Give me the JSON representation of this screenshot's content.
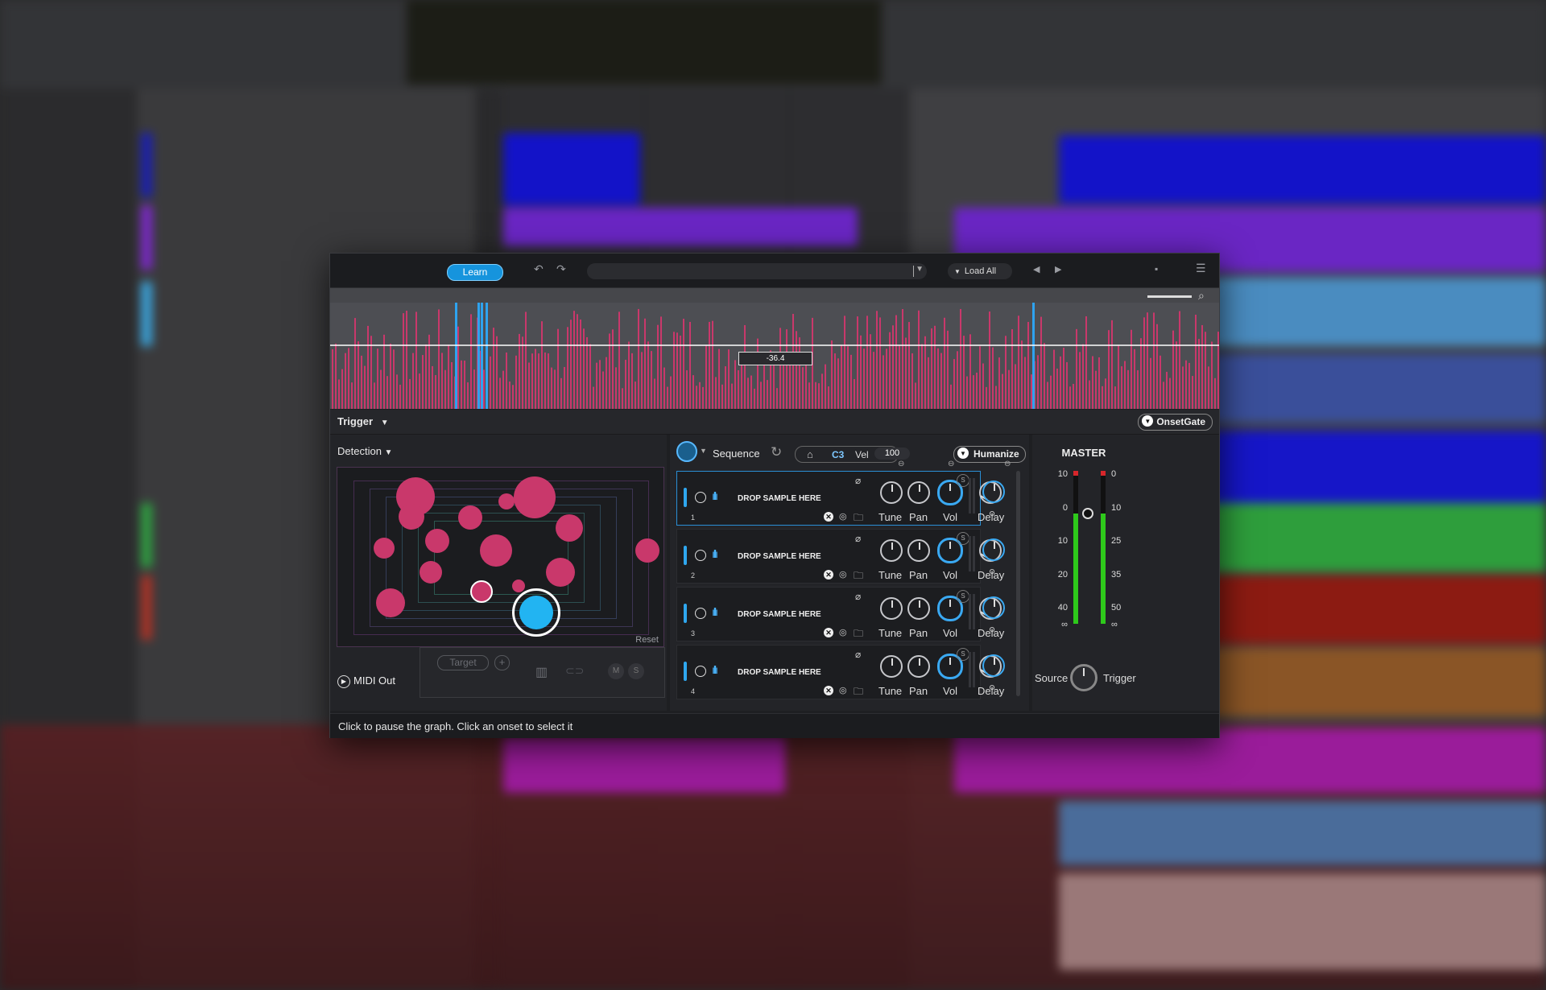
{
  "toolbar": {
    "learn_label": "Learn",
    "preset_name": "",
    "load_all_label": "Load All"
  },
  "waveform": {
    "threshold_value": "-36.4"
  },
  "trigger_bar": {
    "trigger_label": "Trigger",
    "mode_label": "OnsetGate"
  },
  "detection": {
    "label": "Detection",
    "reset_label": "Reset",
    "midi_out_label": "MIDI Out",
    "target_label": "Target",
    "m_label": "M",
    "s_label": "S"
  },
  "sequence": {
    "label": "Sequence",
    "note": "C3",
    "vel_label": "Vel",
    "vel_value": "100",
    "humanize_label": "Humanize",
    "slots": [
      {
        "number": "1",
        "drop_label": "DROP SAMPLE HERE",
        "tune": "Tune",
        "pan": "Pan",
        "vol": "Vol",
        "delay": "Delay",
        "s_badge": "S"
      },
      {
        "number": "2",
        "drop_label": "DROP SAMPLE HERE",
        "tune": "Tune",
        "pan": "Pan",
        "vol": "Vol",
        "delay": "Delay",
        "s_badge": "S"
      },
      {
        "number": "3",
        "drop_label": "DROP SAMPLE HERE",
        "tune": "Tune",
        "pan": "Pan",
        "vol": "Vol",
        "delay": "Delay",
        "s_badge": "S"
      },
      {
        "number": "4",
        "drop_label": "DROP SAMPLE HERE",
        "tune": "Tune",
        "pan": "Pan",
        "vol": "Vol",
        "delay": "Delay",
        "s_badge": "S"
      }
    ]
  },
  "master": {
    "title": "MASTER",
    "left_scale": [
      "10",
      "0",
      "10",
      "20",
      "40",
      "∞"
    ],
    "right_scale": [
      "0",
      "10",
      "25",
      "35",
      "50",
      "∞"
    ],
    "source_label": "Source",
    "trigger_label": "Trigger",
    "meter_levels": [
      0.72,
      0.72
    ]
  },
  "status_text": "Click to pause the graph. Click an onset to select it",
  "colors": {
    "accent_blue": "#1694dd",
    "onset_pink": "#c9386b",
    "meter_green": "#2ec91b"
  }
}
